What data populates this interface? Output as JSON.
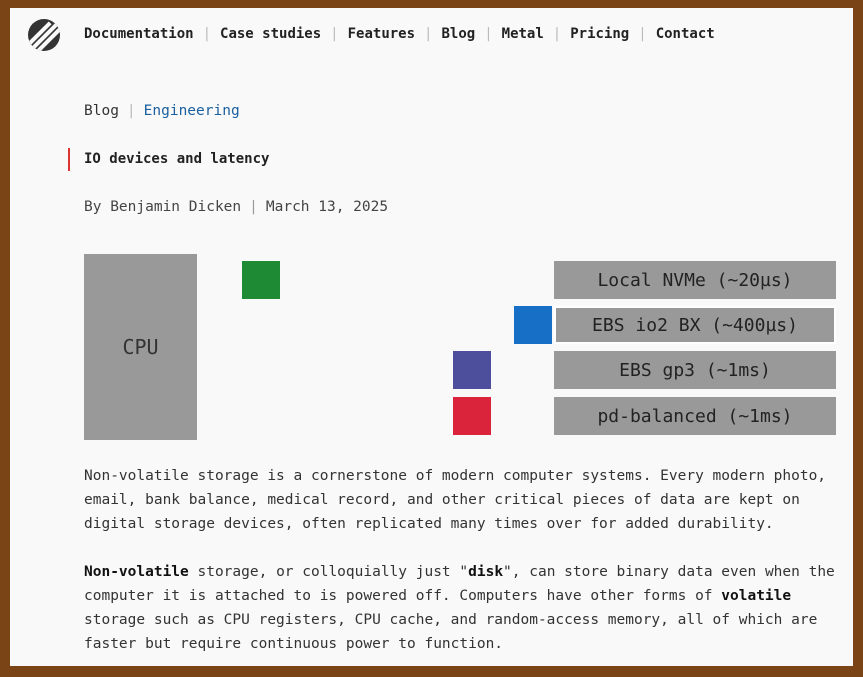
{
  "nav": {
    "items": [
      "Documentation",
      "Case studies",
      "Features",
      "Blog",
      "Metal",
      "Pricing",
      "Contact"
    ]
  },
  "breadcrumb": {
    "blog": "Blog",
    "category": "Engineering"
  },
  "article": {
    "title": "IO devices and latency",
    "author": "By Benjamin Dicken",
    "date": "March 13, 2025"
  },
  "diagram": {
    "cpu_label": "CPU",
    "devices": [
      "Local NVMe (~20µs)",
      "EBS io2 BX (~400µs)",
      "EBS gp3 (~1ms)",
      "pd-balanced (~1ms)"
    ],
    "colors": {
      "green": "#1f8a34",
      "blue": "#1770c6",
      "purple": "#4e4f9c",
      "red": "#d9243b"
    }
  },
  "body": {
    "p1": "Non-volatile storage is a cornerstone of modern computer systems. Every modern photo, email, bank balance, medical record, and other critical pieces of data are kept on digital storage devices, often replicated many times over for added durability.",
    "p2": {
      "b1": "Non-volatile",
      "t1": " storage, or colloquially just \"",
      "b2": "disk",
      "t2": "\", can store binary data even when the computer it is attached to is powered off. Computers have other forms of ",
      "b3": "volatile",
      "t3": " storage such as CPU registers, CPU cache, and random-access memory, all of which are faster but require continuous power to function."
    }
  }
}
